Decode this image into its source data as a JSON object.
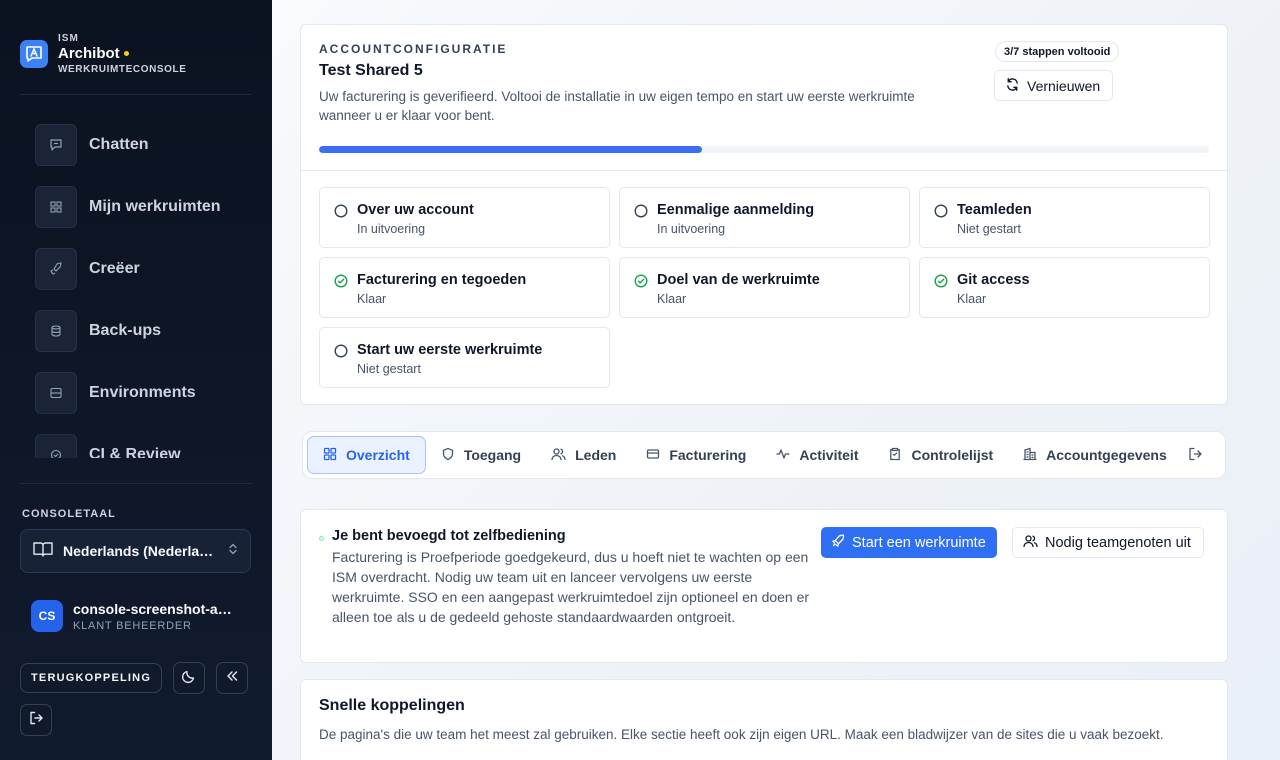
{
  "sidebar": {
    "brand": {
      "org": "ISM",
      "name": "Archibot",
      "subtitle": "WERKRUIMTECONSOLE"
    },
    "nav": [
      {
        "label": "Chatten",
        "icon": "chat-icon"
      },
      {
        "label": "Mijn werkruimten",
        "icon": "grid-icon"
      },
      {
        "label": "Creëer",
        "icon": "rocket-icon"
      },
      {
        "label": "Back-ups",
        "icon": "database-icon"
      },
      {
        "label": "Environments",
        "icon": "server-icon"
      },
      {
        "label": "CI & Review",
        "icon": "check-circle-icon"
      }
    ],
    "language_label": "CONSOLETAAL",
    "language_value": "Nederlands (Nederland)",
    "user": {
      "initials": "CS",
      "name": "console-screenshot-admin",
      "role": "KLANT BEHEERDER"
    },
    "feedback_label": "TERUGKOPPELING"
  },
  "setup": {
    "eyebrow": "ACCOUNTCONFIGURATIE",
    "title": "Test Shared 5",
    "description": "Uw facturering is geverifieerd. Voltooi de installatie in uw eigen tempo en start uw eerste werkruimte wanneer u er klaar voor bent.",
    "steps_badge": "3/7 stappen voltooid",
    "refresh_label": "Vernieuwen",
    "progress_fraction": 0.43,
    "steps": [
      {
        "title": "Over uw account",
        "status": "In uitvoering",
        "done": false
      },
      {
        "title": "Eenmalige aanmelding",
        "status": "In uitvoering",
        "done": false
      },
      {
        "title": "Teamleden",
        "status": "Niet gestart",
        "done": false
      },
      {
        "title": "Facturering en tegoeden",
        "status": "Klaar",
        "done": true
      },
      {
        "title": "Doel van de werkruimte",
        "status": "Klaar",
        "done": true
      },
      {
        "title": "Git access",
        "status": "Klaar",
        "done": true
      },
      {
        "title": "Start uw eerste werkruimte",
        "status": "Niet gestart",
        "done": false
      }
    ]
  },
  "tabs": [
    {
      "label": "Overzicht",
      "icon": "grid-icon",
      "active": true
    },
    {
      "label": "Toegang",
      "icon": "shield-icon",
      "active": false
    },
    {
      "label": "Leden",
      "icon": "users-icon",
      "active": false
    },
    {
      "label": "Facturering",
      "icon": "credit-card-icon",
      "active": false
    },
    {
      "label": "Activiteit",
      "icon": "activity-icon",
      "active": false
    },
    {
      "label": "Controlelijst",
      "icon": "clipboard-icon",
      "active": false
    },
    {
      "label": "Accountgegevens",
      "icon": "building-icon",
      "active": false
    }
  ],
  "self_service": {
    "title": "Je bent bevoegd tot zelfbediening",
    "description": "Facturering is Proefperiode goedgekeurd, dus u hoeft niet te wachten op een ISM overdracht. Nodig uw team uit en lanceer vervolgens uw eerste werkruimte. SSO en een aangepast werkruimtedoel zijn optioneel en doen er alleen toe als u de gedeeld gehoste standaardwaarden ontgroeit.",
    "primary_label": "Start een werkruimte",
    "secondary_label": "Nodig teamgenoten uit"
  },
  "quick_links": {
    "title": "Snelle koppelingen",
    "description": "De pagina's die uw team het meest zal gebruiken. Elke sectie heeft ook zijn eigen URL. Maak een bladwijzer van de sites die u vaak bezoekt."
  },
  "colors": {
    "accent": "#2f6ff3",
    "success": "#16a34a",
    "sidebar_bg": "#0b1220"
  }
}
